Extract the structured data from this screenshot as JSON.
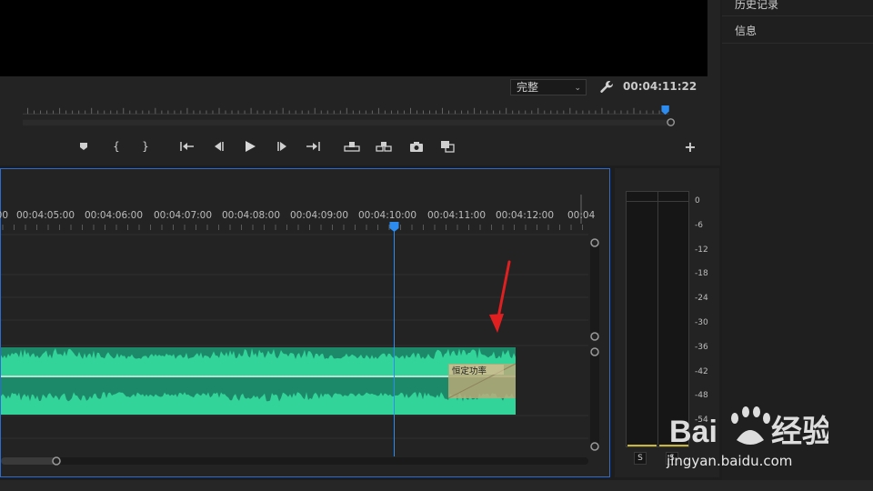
{
  "history_panel": {
    "title": "历史记录"
  },
  "info_panel": {
    "title": "信息"
  },
  "program_monitor": {
    "fit_value": "完整",
    "timecode": "00:04:11:22",
    "icons": {
      "settings": "wrench-icon",
      "fit_dropdown": "chevron-down-icon"
    }
  },
  "transport_controls": [
    {
      "name": "add-marker-button",
      "glyph": "⬟"
    },
    {
      "name": "mark-in-button",
      "glyph": "{"
    },
    {
      "name": "mark-out-button",
      "glyph": "}"
    },
    {
      "name": "go-to-in-button",
      "glyph": "{←"
    },
    {
      "name": "step-back-button",
      "glyph": "◀|"
    },
    {
      "name": "play-button",
      "glyph": "▶"
    },
    {
      "name": "step-forward-button",
      "glyph": "|▶"
    },
    {
      "name": "go-to-out-button",
      "glyph": "→}"
    },
    {
      "name": "lift-button",
      "glyph": "⊓"
    },
    {
      "name": "extract-button",
      "glyph": "⊓"
    },
    {
      "name": "export-frame-button",
      "glyph": "camera"
    },
    {
      "name": "comparison-view-button",
      "glyph": "▣"
    }
  ],
  "add_button_label": "+",
  "timeline": {
    "ruler_labels": [
      "00",
      "00:04:05:00",
      "00:04:06:00",
      "00:04:07:00",
      "00:04:08:00",
      "00:04:09:00",
      "00:04:10:00",
      "00:04:11:00",
      "00:04:12:00",
      "00:04"
    ],
    "clip_label": "恒定功率",
    "accent_color": "#2d8cf0",
    "clip_color": "#1c8a68",
    "waveform_color": "#33d49a",
    "transition_color": "#b9a978"
  },
  "audio_meter": {
    "scale": [
      "0",
      "-6",
      "-12",
      "-18",
      "-24",
      "-30",
      "-36",
      "-42",
      "-48",
      "-54"
    ],
    "solo_labels": [
      "S",
      "S"
    ]
  },
  "watermark": {
    "url": "jingyan.baidu.com"
  }
}
